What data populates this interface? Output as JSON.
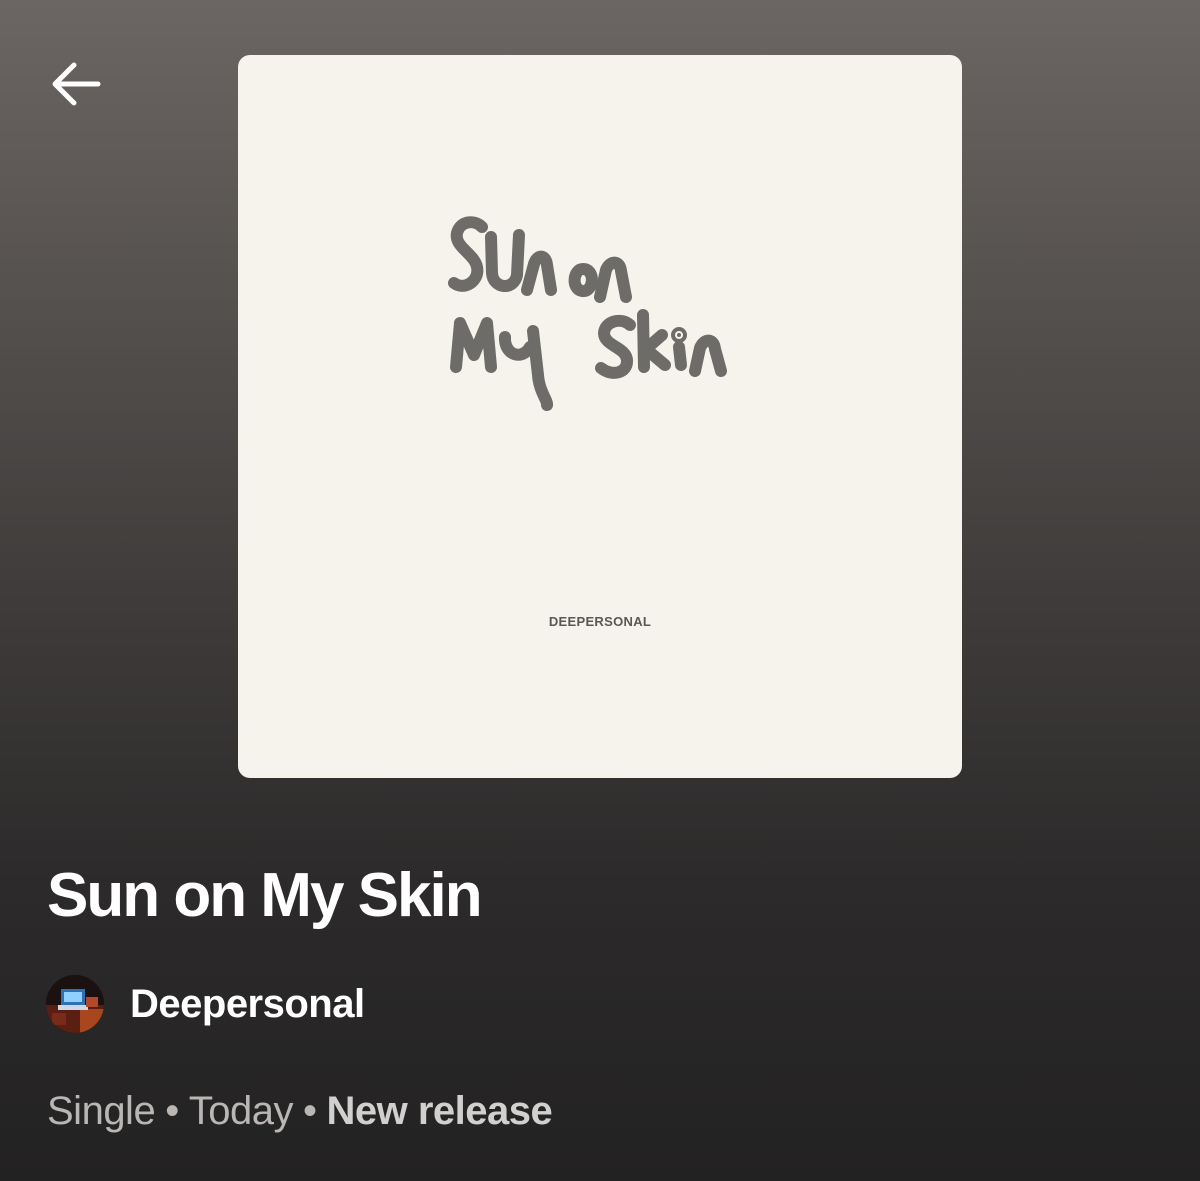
{
  "album": {
    "cover_artist_text": "DEEPERSONAL",
    "title": "Sun on My Skin",
    "artist": "Deepersonal",
    "meta": {
      "type": "Single",
      "separator": "•",
      "date": "Today",
      "badge": "New release"
    }
  },
  "icons": {
    "back": "arrow-left-icon",
    "avatar": "artist-avatar"
  },
  "colors": {
    "background_top": "#6b6664",
    "background_bottom": "#232222",
    "cover_background": "#f6f2ec",
    "handwriting": "#6e6c69",
    "text_primary": "#ffffff",
    "text_secondary": "#b9b6b4"
  }
}
